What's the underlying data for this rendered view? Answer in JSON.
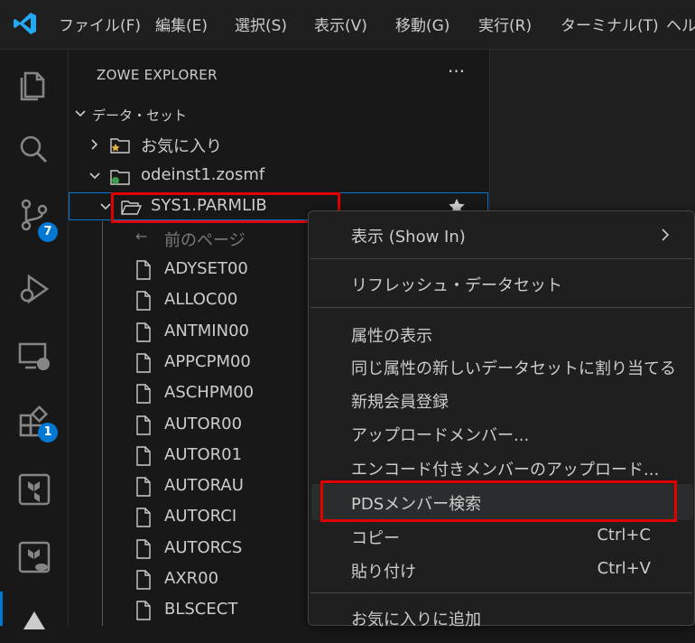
{
  "menubar": {
    "items": [
      "ファイル(F)",
      "編集(E)",
      "選択(S)",
      "表示(V)",
      "移動(G)",
      "実行(R)",
      "ターミナル(T)",
      "ヘル"
    ]
  },
  "activity": {
    "scm_badge": "7",
    "extensions_badge": "1"
  },
  "sidebar": {
    "title": "ZOWE EXPLORER",
    "more": "···",
    "section": "データ・セット",
    "favorites": "お気に入り",
    "profile": "odeinst1.zosmf",
    "dataset": "SYS1.PARMLIB",
    "prev_page": "前のページ",
    "members": [
      "ADYSET00",
      "ALLOC00",
      "ANTMIN00",
      "APPCPM00",
      "ASCHPM00",
      "AUTOR00",
      "AUTOR01",
      "AUTORAU",
      "AUTORCI",
      "AUTORCS",
      "AXR00",
      "BLSCECT"
    ]
  },
  "context_menu": {
    "show_in": "表示 (Show In)",
    "refresh": "リフレッシュ・データセット",
    "show_attributes": "属性の表示",
    "allocate_like": "同じ属性の新しいデータセットに割り当てる",
    "create_member": "新規会員登録",
    "upload_member": "アップロードメンバー...",
    "upload_encoding": "エンコード付きメンバーのアップロード...",
    "search_pds": "PDSメンバー検索",
    "copy": "コピー",
    "copy_key": "Ctrl+C",
    "paste": "貼り付け",
    "paste_key": "Ctrl+V",
    "add_favorite": "お気に入りに追加"
  }
}
